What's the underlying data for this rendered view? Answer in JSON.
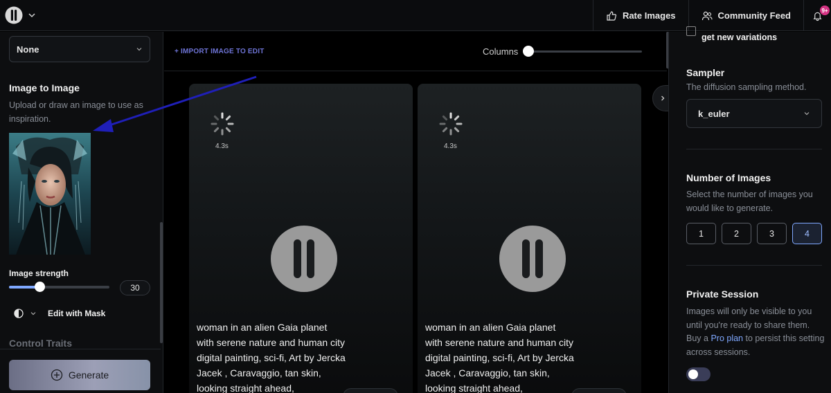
{
  "topbar": {
    "rate_images": "Rate Images",
    "community_feed": "Community Feed",
    "notif_count": "9+"
  },
  "left": {
    "preset_select": "None",
    "img2img_title": "Image to Image",
    "img2img_desc": "Upload or draw an image to use as inspiration.",
    "strength_label": "Image strength",
    "strength_value": "30",
    "strength_fraction": 0.3,
    "mask_label": "Edit with Mask",
    "control_traits": "Control Traits",
    "generate_label": "Generate"
  },
  "center": {
    "import_label": "+ IMPORT IMAGE TO EDIT",
    "columns_label": "Columns",
    "cards": [
      {
        "timer": "4.3s",
        "prompt": "woman in an alien Gaia planet with serene nature and human city digital painting, sci-fi, Art by Jercka Jacek , Caravaggio, tan skin, looking straight ahead,"
      },
      {
        "timer": "4.3s",
        "prompt": "woman in an alien Gaia planet with serene nature and human city digital painting, sci-fi, Art by Jercka Jacek , Caravaggio, tan skin, looking straight ahead,"
      }
    ]
  },
  "right": {
    "variations_label": "get new variations",
    "sampler_title": "Sampler",
    "sampler_desc": "The diffusion sampling method.",
    "sampler_value": "k_euler",
    "num_images_title": "Number of Images",
    "num_images_desc": "Select the number of images you would like to generate.",
    "num_options": [
      "1",
      "2",
      "3",
      "4"
    ],
    "num_selected": "4",
    "private_title": "Private Session",
    "private_desc_1": "Images will only be visible to you until you're ready to share them. Buy a ",
    "private_link": "Pro plan",
    "private_desc_2": " to persist this setting across sessions.",
    "private_enabled": false
  },
  "colors": {
    "accent": "#7fa8ff",
    "import_link": "#6e74d6",
    "annotation_arrow": "#1f1fb8"
  }
}
